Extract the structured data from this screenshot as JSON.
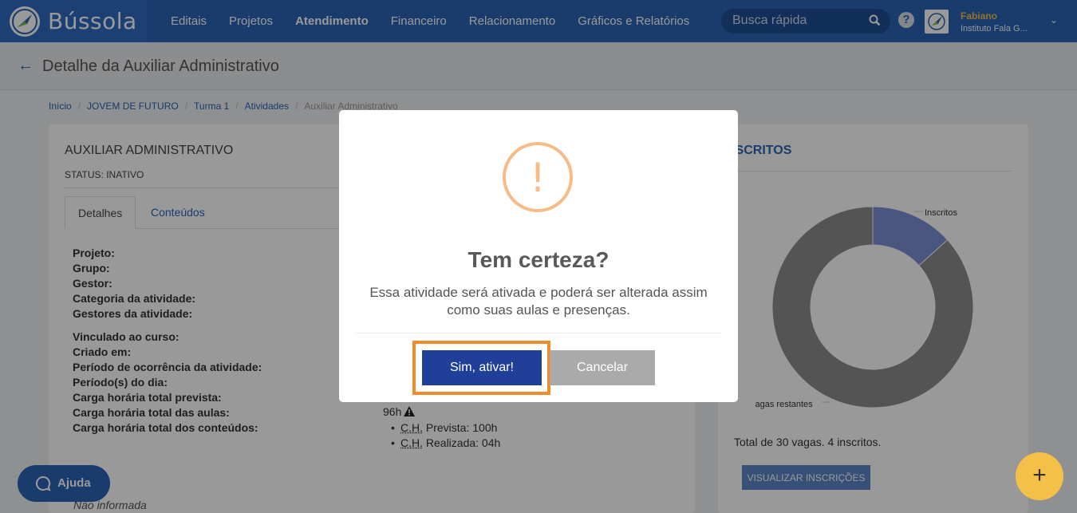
{
  "app": {
    "brand": "Bússola"
  },
  "nav": {
    "items": [
      {
        "label": "Editais",
        "active": false
      },
      {
        "label": "Projetos",
        "active": false
      },
      {
        "label": "Atendimento",
        "active": true
      },
      {
        "label": "Financeiro",
        "active": false
      },
      {
        "label": "Relacionamento",
        "active": false
      },
      {
        "label": "Gráficos e Relatórios",
        "active": false
      }
    ],
    "search_placeholder": "Busca rápida",
    "help_icon": "?",
    "user_name": "Fabiano",
    "user_org": "Instituto Fala G..."
  },
  "page": {
    "back_icon": "←",
    "title": "Detalhe da Auxiliar Administrativo",
    "breadcrumb": [
      {
        "label": "Início"
      },
      {
        "label": "JOVEM DE FUTURO"
      },
      {
        "label": "Turma 1"
      },
      {
        "label": "Atividades"
      },
      {
        "label": "Auxiliar Administrativo"
      }
    ]
  },
  "activity": {
    "title": "AUXILIAR ADMINISTRATIVO",
    "status": "STATUS:  INATIVO",
    "tabs": [
      "Detalhes",
      "Conteúdos"
    ],
    "fields_a": [
      "Projeto:",
      "Grupo:",
      "Gestor:",
      "Categoria da atividade:",
      "Gestores da atividade:"
    ],
    "fields_b": [
      "Vinculado ao curso:",
      "Criado em:",
      "Período de ocorrência da atividade:",
      "Período(s) do dia:",
      "Carga horária total prevista:",
      "Carga horária total das aulas:",
      "Carga horária total dos conteúdos:"
    ],
    "hours_total": "96h",
    "hours_breakdown": [
      {
        "abbr": "C.H.",
        "text": " Prevista: 100h"
      },
      {
        "abbr": "C.H.",
        "text": " Realizada: 04h"
      }
    ],
    "description_label": "ão",
    "description_value": "Não informada"
  },
  "enrollment": {
    "title": "NSCRITOS",
    "legend_enrolled": "Inscritos",
    "legend_remaining": "Vagas restantes",
    "total_text": "Total de 30 vagas. 4 inscritos.",
    "view_button": "VISUALIZAR INSCRIÇÕES",
    "colors": {
      "enrolled": "#7b8fd6",
      "remaining": "#8c8c8c"
    }
  },
  "chart_data": {
    "type": "pie",
    "categories": [
      "Inscritos",
      "Vagas restantes"
    ],
    "values": [
      4,
      26
    ]
  },
  "floating": {
    "help_label": "Ajuda",
    "fab_label": "+"
  },
  "modal": {
    "icon": "!",
    "title": "Tem certeza?",
    "text": "Essa atividade será ativada e poderá ser alterada assim como suas aulas e presenças.",
    "confirm_label": "Sim, ativar!",
    "cancel_label": "Cancelar",
    "colors": {
      "confirm": "#1f3f98",
      "highlight": "#f08c2b",
      "warning": "#f8bb86"
    }
  }
}
